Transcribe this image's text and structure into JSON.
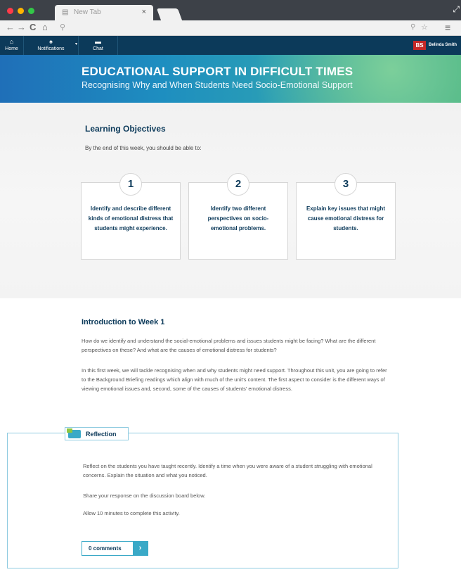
{
  "browser": {
    "tab_title": "New Tab",
    "tab_close": "×",
    "tab_icon": "page-icon",
    "search_glyph": "⚲"
  },
  "nav": {
    "home": "Home",
    "notifications": "Notifications",
    "chat": "Chat",
    "avatar_initials": "BS",
    "username": "Belinda Smith"
  },
  "banner": {
    "title": "EDUCATIONAL SUPPORT IN DIFFICULT TIMES",
    "subtitle": "Recognising Why and When Students Need Socio-Emotional Support"
  },
  "objectives": {
    "heading": "Learning Objectives",
    "intro": "By the end of this week, you should be able to:",
    "items": [
      {
        "number": "1",
        "text": "Identify and describe different kinds of emotional distress that students might experience."
      },
      {
        "number": "2",
        "text": "Identify two different perspectives on socio-emotional problems."
      },
      {
        "number": "3",
        "text": "Explain key issues that might cause emotional distress for students."
      }
    ]
  },
  "introduction": {
    "heading": "Introduction to Week 1",
    "paragraphs": [
      "How do we identify and understand the social-emotional problems and issues students might be facing? What are the different perspectives on these? And what are the causes of emotional distress for students?",
      "In this first week, we will tackle recognising when and why students might need support. Throughout this unit, you are going to refer to the Background Briefing readings which align with much of the unit's content. The first aspect to consider is the different ways of viewing emotional issues and, second, some of the causes of students' emotional distress."
    ]
  },
  "reflection": {
    "label": "Reflection",
    "paragraphs": [
      "Reflect on the students you have taught recently. Identify a time when you were aware of a student struggling with emotional concerns. Explain the situation and what you noticed.",
      "Share your response on the discussion board below.",
      "Allow 10 minutes to complete this activity."
    ],
    "comments_label": "0 comments",
    "comments_arrow": "›"
  },
  "colors": {
    "navy": "#0c3a5a",
    "accent": "#3aa9c7",
    "avatar": "#c62828"
  }
}
